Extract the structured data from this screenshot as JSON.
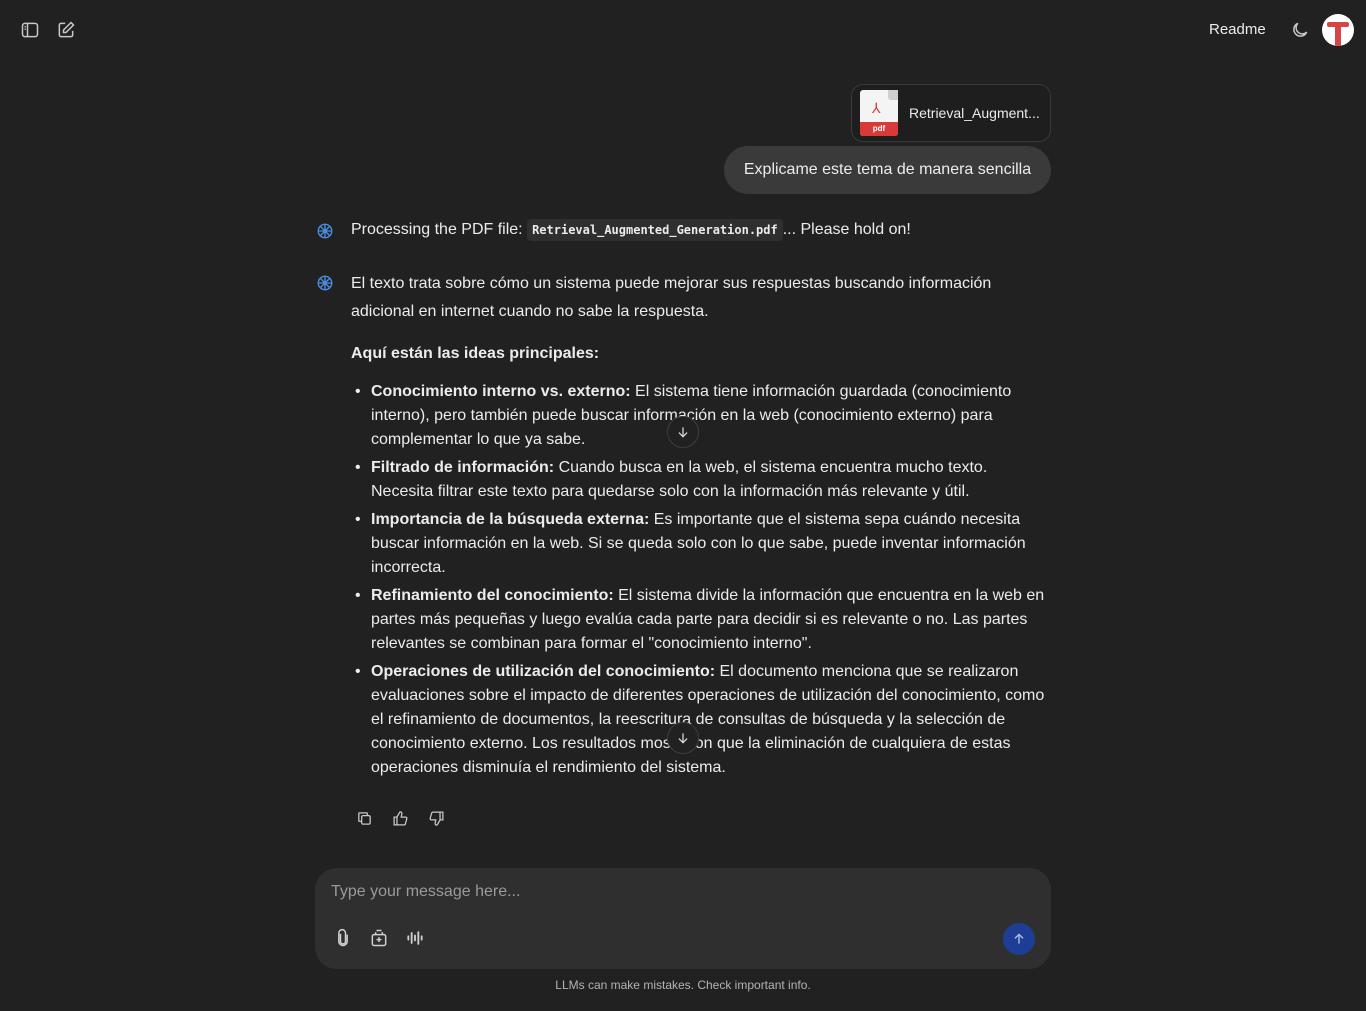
{
  "topbar": {
    "readme_label": "Readme"
  },
  "conversation": {
    "attachment": {
      "file_name": "Retrieval_Augment...",
      "file_type_label": "pdf"
    },
    "user_message": "Explicame este tema de manera sencilla",
    "processing": {
      "prefix": "Processing the PDF file: ",
      "file_code": "Retrieval_Augmented_Generation.pdf",
      "suffix": "... Please hold on!"
    },
    "answer": {
      "intro": "El texto trata sobre cómo un sistema puede mejorar sus respuestas buscando información adicional en internet cuando no sabe la respuesta.",
      "heading": "Aquí están las ideas principales:",
      "points": [
        {
          "title": "Conocimiento interno vs. externo:",
          "text": " El sistema tiene información guardada (conocimiento interno), pero también puede buscar información en la web (conocimiento externo) para complementar lo que ya sabe."
        },
        {
          "title": "Filtrado de información:",
          "text": " Cuando busca en la web, el sistema encuentra mucho texto. Necesita filtrar este texto para quedarse solo con la información más relevante y útil."
        },
        {
          "title": "Importancia de la búsqueda externa:",
          "text": " Es importante que el sistema sepa cuándo necesita buscar información en la web. Si se queda solo con lo que sabe, puede inventar información incorrecta."
        },
        {
          "title": "Refinamiento del conocimiento:",
          "text": " El sistema divide la información que encuentra en la web en partes más pequeñas y luego evalúa cada parte para decidir si es relevante o no. Las partes relevantes se combinan para formar el \"conocimiento interno\"."
        },
        {
          "title": "Operaciones de utilización del conocimiento:",
          "text": " El documento menciona que se realizaron evaluaciones sobre el impacto de diferentes operaciones de utilización del conocimiento, como el refinamiento de documentos, la reescritura de consultas de búsqueda y la selección de conocimiento externo. Los resultados mostraron que la eliminación de cualquiera de estas operaciones disminuía el rendimiento del sistema."
        }
      ]
    }
  },
  "composer": {
    "placeholder": "Type your message here..."
  },
  "footer": {
    "note": "LLMs can make mistakes. Check important info."
  },
  "colors": {
    "background": "#212121",
    "user_bubble": "#3a3a3a",
    "composer": "#2f2f2f",
    "send_button": "#1d3e94",
    "pdf_red": "#d83a3a",
    "avatar_red": "#d64545",
    "bot_icon": "#4a90e2"
  },
  "icons": [
    "sidebar-toggle-icon",
    "new-chat-icon",
    "moon-icon",
    "pdf-icon",
    "brain-icon",
    "arrow-down-icon",
    "copy-icon",
    "thumbs-up-icon",
    "thumbs-down-icon",
    "paperclip-icon",
    "tools-icon",
    "voice-wave-icon",
    "arrow-up-icon"
  ]
}
